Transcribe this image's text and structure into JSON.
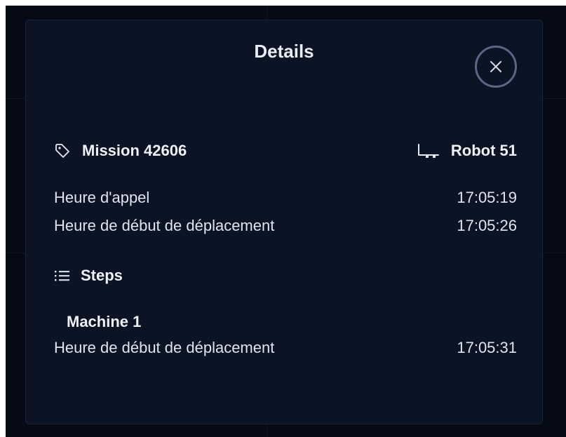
{
  "dialog": {
    "title": "Details",
    "close_icon": "close-icon"
  },
  "mission": {
    "icon": "tag-icon",
    "label": "Mission 42606"
  },
  "robot": {
    "icon": "robot-cart-icon",
    "label": "Robot 51"
  },
  "times": [
    {
      "label": "Heure d'appel",
      "value": "17:05:19"
    },
    {
      "label": "Heure de début de déplacement",
      "value": "17:05:26"
    }
  ],
  "steps": {
    "icon": "list-icon",
    "label": "Steps",
    "items": [
      {
        "title": "Machine 1",
        "label": "Heure de début de déplacement",
        "value": "17:05:31"
      }
    ]
  },
  "colors": {
    "backdrop": "#060a14",
    "panel": "#0a1425",
    "text": "#e6eaf2",
    "close_ring": "#5b6584"
  }
}
